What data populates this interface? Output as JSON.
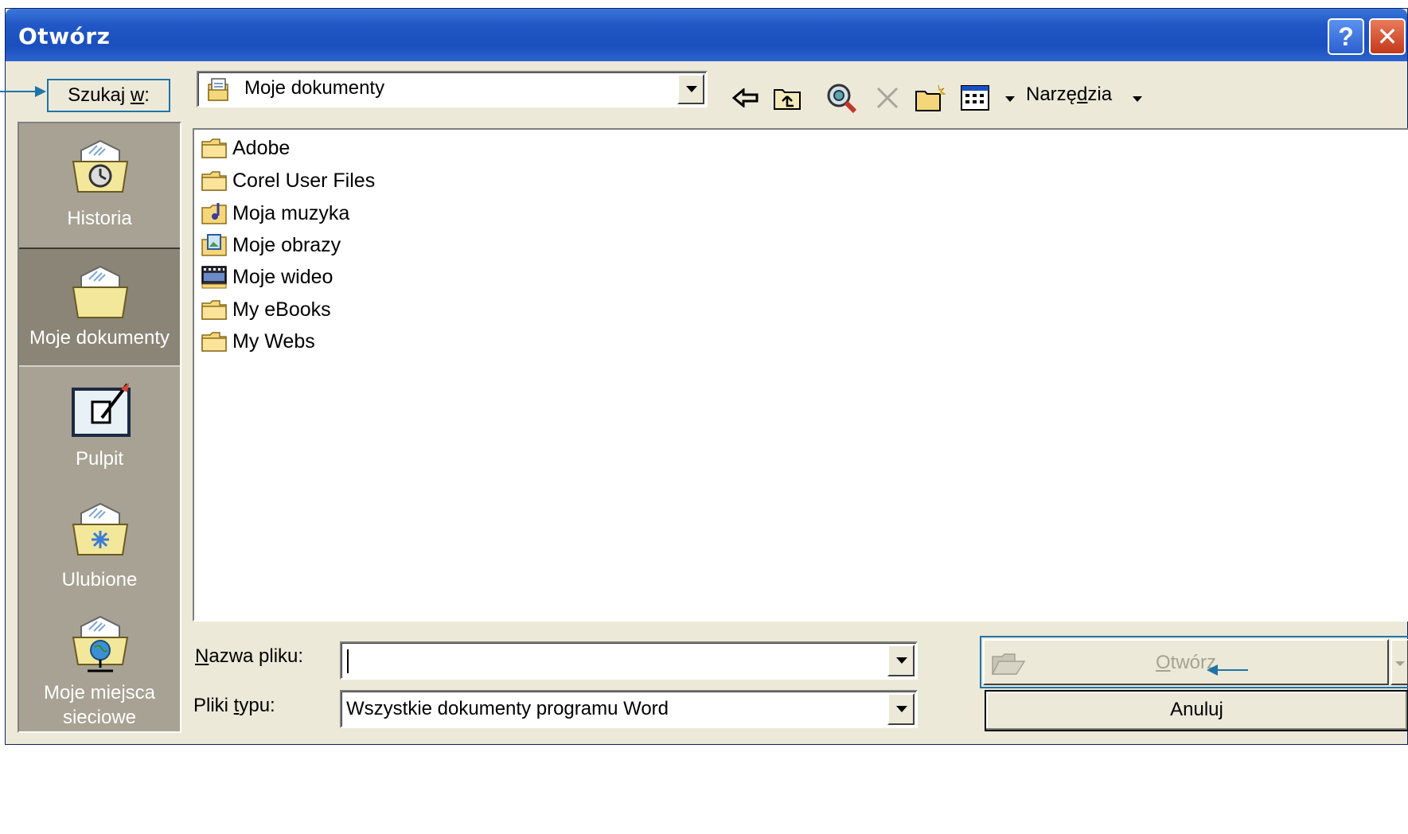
{
  "window": {
    "title": "Otwórz"
  },
  "titlebar": {
    "help_glyph": "?",
    "close_glyph": "✕"
  },
  "toolbar": {
    "look_in_label_pre": "Szukaj ",
    "look_in_label_key": "w",
    "look_in_label_post": ":",
    "look_in_value": "Moje dokumenty",
    "tools_label_pre": "Narzę",
    "tools_label_key": "d",
    "tools_label_post": "zia",
    "icons": [
      "back-icon",
      "up-folder-icon",
      "search-web-icon",
      "delete-icon",
      "new-folder-icon",
      "views-icon"
    ]
  },
  "places": [
    {
      "label": "Historia",
      "icon": "history-icon"
    },
    {
      "label": "Moje dokumenty",
      "icon": "my-documents-icon",
      "selected": true
    },
    {
      "label": "Pulpit",
      "icon": "desktop-icon"
    },
    {
      "label": "Ulubione",
      "icon": "favorites-icon"
    },
    {
      "label_line1": "Moje miejsca",
      "label_line2": "sieciowe",
      "icon": "network-places-icon"
    }
  ],
  "files": [
    {
      "name": "Adobe",
      "icon": "folder-icon"
    },
    {
      "name": "Corel User Files",
      "icon": "folder-icon"
    },
    {
      "name": "Moja muzyka",
      "icon": "music-folder-icon"
    },
    {
      "name": "Moje obrazy",
      "icon": "pictures-folder-icon"
    },
    {
      "name": "Moje wideo",
      "icon": "video-folder-icon"
    },
    {
      "name": "My eBooks",
      "icon": "folder-icon"
    },
    {
      "name": "My Webs",
      "icon": "folder-icon"
    }
  ],
  "bottom": {
    "filename_label_key": "N",
    "filename_label_rest": "azwa pliku:",
    "filename_value": "",
    "filetype_label_pre": "Pliki ",
    "filetype_label_key": "t",
    "filetype_label_post": "ypu:",
    "filetype_value": "Wszystkie dokumenty programu Word",
    "open_label_key": "O",
    "open_label_rest": "twórz",
    "cancel_label": "Anuluj"
  },
  "colors": {
    "titlebar": "#2257c6",
    "callout": "#1e74a8",
    "places_bg": "#a7a293",
    "dialog_bg": "#ece9d8"
  }
}
